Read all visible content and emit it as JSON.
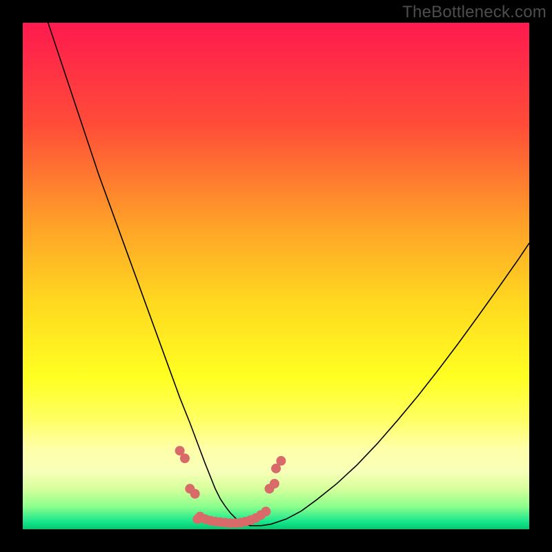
{
  "watermark": "TheBottleneck.com",
  "chart_data": {
    "type": "line",
    "title": "",
    "xlabel": "",
    "ylabel": "",
    "xlim": [
      0,
      100
    ],
    "ylim": [
      0,
      100
    ],
    "grid": false,
    "legend": false,
    "background_gradient": {
      "stops": [
        {
          "offset": 0.0,
          "color": "#ff1a4f"
        },
        {
          "offset": 0.2,
          "color": "#ff4c38"
        },
        {
          "offset": 0.4,
          "color": "#ffa228"
        },
        {
          "offset": 0.55,
          "color": "#ffd820"
        },
        {
          "offset": 0.7,
          "color": "#ffff22"
        },
        {
          "offset": 0.78,
          "color": "#ffff60"
        },
        {
          "offset": 0.84,
          "color": "#ffffa8"
        },
        {
          "offset": 0.885,
          "color": "#f8ffb8"
        },
        {
          "offset": 0.92,
          "color": "#d6ff9c"
        },
        {
          "offset": 0.955,
          "color": "#8cff8c"
        },
        {
          "offset": 0.985,
          "color": "#18e68c"
        },
        {
          "offset": 1.0,
          "color": "#00c96e"
        }
      ]
    },
    "series": [
      {
        "name": "curve",
        "color": "#000000",
        "stroke_width": 1.6,
        "x": [
          5,
          7,
          9,
          11,
          13,
          15,
          17,
          19,
          21,
          23,
          25,
          27,
          29,
          31,
          33,
          34.5,
          36,
          37,
          38,
          39,
          40,
          41,
          42,
          43,
          44,
          45,
          47,
          49,
          52,
          55,
          58,
          62,
          66,
          70,
          74,
          78,
          82,
          86,
          90,
          94,
          98,
          100
        ],
        "y": [
          100,
          94,
          88,
          82,
          76,
          70,
          64.5,
          59,
          53.5,
          48,
          42.5,
          37,
          31.5,
          26,
          21,
          17,
          13,
          10.5,
          8,
          6,
          4.5,
          3.2,
          2.2,
          1.4,
          0.9,
          0.7,
          0.7,
          1,
          2,
          3.6,
          5.8,
          9,
          12.7,
          16.9,
          21.5,
          26.3,
          31.4,
          36.7,
          42.2,
          47.8,
          53.5,
          56.5
        ]
      },
      {
        "name": "markers",
        "type": "scatter",
        "color": "#d86a6a",
        "marker_size": 14,
        "points": [
          {
            "x": 31.0,
            "y": 15.5
          },
          {
            "x": 32.0,
            "y": 14.0
          },
          {
            "x": 33.0,
            "y": 8.0
          },
          {
            "x": 34.0,
            "y": 7.0
          },
          {
            "x": 34.5,
            "y": 2.0
          },
          {
            "x": 35.0,
            "y": 2.5
          },
          {
            "x": 36.0,
            "y": 2.0
          },
          {
            "x": 37.0,
            "y": 1.7
          },
          {
            "x": 38.0,
            "y": 1.5
          },
          {
            "x": 39.0,
            "y": 1.4
          },
          {
            "x": 40.0,
            "y": 1.3
          },
          {
            "x": 41.0,
            "y": 1.2
          },
          {
            "x": 42.0,
            "y": 1.2
          },
          {
            "x": 43.0,
            "y": 1.3
          },
          {
            "x": 44.0,
            "y": 1.5
          },
          {
            "x": 45.0,
            "y": 1.8
          },
          {
            "x": 46.0,
            "y": 2.2
          },
          {
            "x": 47.0,
            "y": 2.8
          },
          {
            "x": 48.0,
            "y": 3.5
          },
          {
            "x": 48.7,
            "y": 8.0
          },
          {
            "x": 49.7,
            "y": 9.0
          },
          {
            "x": 50.0,
            "y": 12.0
          },
          {
            "x": 51.0,
            "y": 13.5
          }
        ]
      }
    ]
  }
}
